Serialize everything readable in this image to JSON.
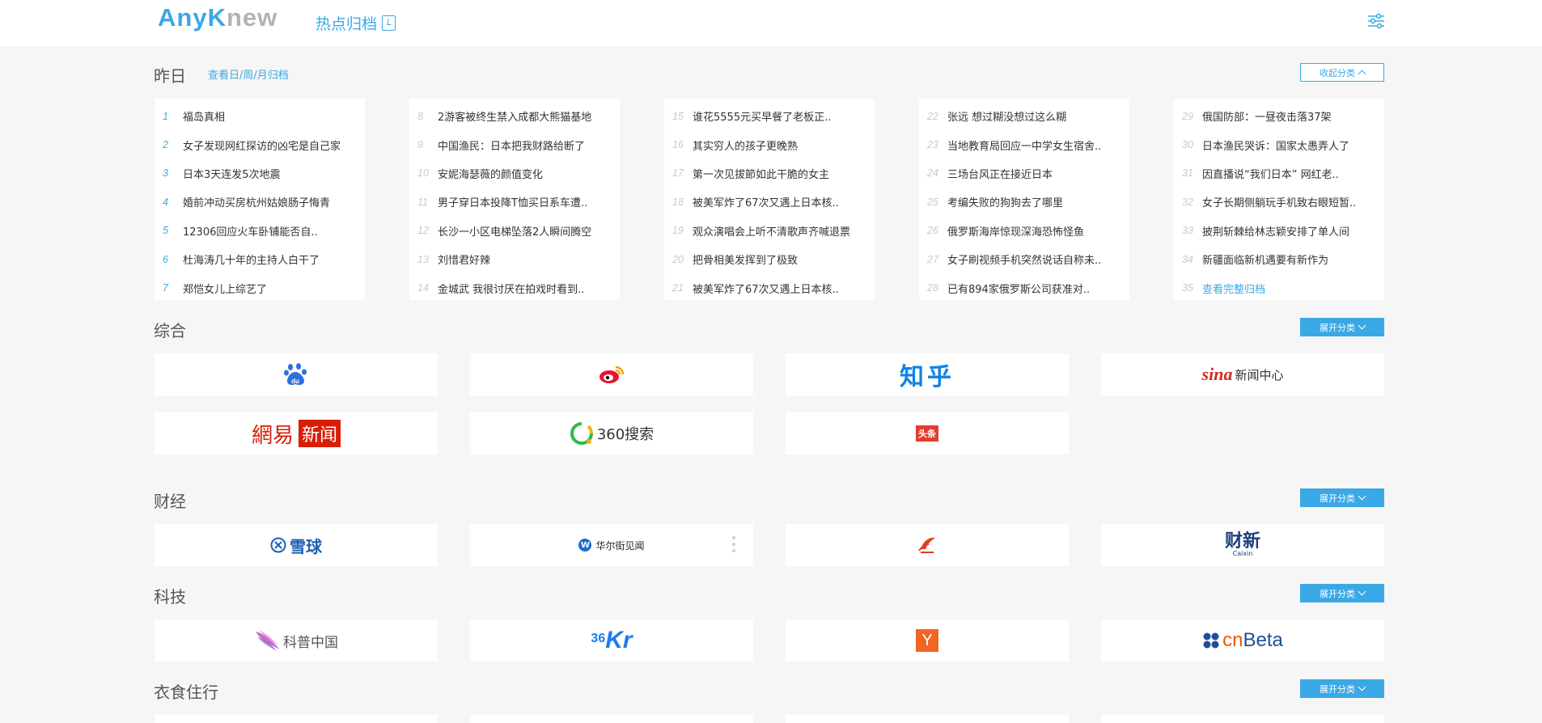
{
  "header": {
    "logo_any": "Any",
    "logo_k": "K",
    "logo_new": "new",
    "archive_label": "热点归档"
  },
  "yesterday": {
    "title": "昨日",
    "sub_link": "查看日/周/月归档",
    "collapse_label": "收起分类",
    "columns": [
      [
        {
          "n": "1",
          "t": "福岛真相"
        },
        {
          "n": "2",
          "t": "女子发现网红探访的凶宅是自己家"
        },
        {
          "n": "3",
          "t": "日本3天连发5次地震"
        },
        {
          "n": "4",
          "t": "婚前冲动买房杭州姑娘肠子悔青"
        },
        {
          "n": "5",
          "t": "12306回应火车卧铺能否自.."
        },
        {
          "n": "6",
          "t": "杜海涛几十年的主持人白干了"
        },
        {
          "n": "7",
          "t": "郑恺女儿上综艺了"
        }
      ],
      [
        {
          "n": "8",
          "t": "2游客被终生禁入成都大熊猫基地"
        },
        {
          "n": "9",
          "t": "中国渔民：日本把我财路给断了"
        },
        {
          "n": "10",
          "t": "安妮海瑟薇的颜值变化"
        },
        {
          "n": "11",
          "t": "男子穿日本投降T恤买日系车遭.."
        },
        {
          "n": "12",
          "t": "长沙一小区电梯坠落2人瞬间腾空"
        },
        {
          "n": "13",
          "t": "刘惜君好辣"
        },
        {
          "n": "14",
          "t": "金城武 我很讨厌在拍戏时看到.."
        }
      ],
      [
        {
          "n": "15",
          "t": "谁花5555元买早餐了老板正.."
        },
        {
          "n": "16",
          "t": "其实穷人的孩子更晚熟"
        },
        {
          "n": "17",
          "t": "第一次见拔節如此干脆的女主"
        },
        {
          "n": "18",
          "t": "被美军炸了67次又遇上日本核.."
        },
        {
          "n": "19",
          "t": "观众演唱会上听不清歌声齐喊退票"
        },
        {
          "n": "20",
          "t": "把骨相美发挥到了极致"
        },
        {
          "n": "21",
          "t": "被美军炸了67次又遇上日本核.."
        }
      ],
      [
        {
          "n": "22",
          "t": "张远 想过糊没想过这么糊"
        },
        {
          "n": "23",
          "t": "当地教育局回应一中学女生宿舍.."
        },
        {
          "n": "24",
          "t": "三场台风正在接近日本"
        },
        {
          "n": "25",
          "t": "考编失败的狗狗去了哪里"
        },
        {
          "n": "26",
          "t": "俄罗斯海岸惊现深海恐怖怪鱼"
        },
        {
          "n": "27",
          "t": "女子刷视频手机突然说话自称未.."
        },
        {
          "n": "28",
          "t": "已有894家俄罗斯公司获准对.."
        }
      ],
      [
        {
          "n": "29",
          "t": "俄国防部：一昼夜击落37架"
        },
        {
          "n": "30",
          "t": "日本渔民哭诉：国家太愚弄人了"
        },
        {
          "n": "31",
          "t": "因直播说“我们日本” 网红老.."
        },
        {
          "n": "32",
          "t": "女子长期侧躺玩手机致右眼短暂.."
        },
        {
          "n": "33",
          "t": "披荆斩棘给林志颖安排了单人间"
        },
        {
          "n": "34",
          "t": "新疆面临新机遇要有新作为"
        },
        {
          "n": "35",
          "t": "查看完整归档"
        }
      ]
    ]
  },
  "sections": {
    "general": {
      "title": "综合",
      "expand_label": "展开分类"
    },
    "finance": {
      "title": "财经",
      "expand_label": "展开分类"
    },
    "tech": {
      "title": "科技",
      "expand_label": "展开分类"
    },
    "life": {
      "title": "衣食住行",
      "expand_label": "展开分类"
    }
  },
  "logos": {
    "zhihu": "知乎",
    "sina": "新闻中心",
    "sina_brand": "sina",
    "netease_a": "網易",
    "netease_b": "新闻",
    "so360": "360搜索",
    "toutiao": "头条",
    "xueqiu": "雪球",
    "wallstreet": "华尔街见闻",
    "caixin": "财新",
    "caixin_en": "Caixin",
    "kepu": "科普中国",
    "kr36_a": "36",
    "kr36_b": "Kr",
    "yc": "Y",
    "cnbeta_a": "cn",
    "cnbeta_b": "Beta",
    "baidu": "du"
  },
  "colors": {
    "accent": "#3ba8e6",
    "background": "#f6f6f6"
  }
}
